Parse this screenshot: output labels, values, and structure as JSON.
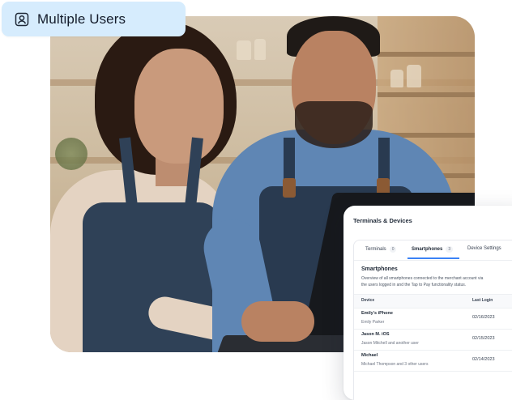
{
  "badge": {
    "label": "Multiple Users",
    "icon": "user-square-icon"
  },
  "card": {
    "title": "Terminals & Devices",
    "tabs": [
      {
        "label": "Terminals",
        "count": "0",
        "active": false
      },
      {
        "label": "Smartphones",
        "count": "3",
        "active": true
      },
      {
        "label": "Device Settings",
        "count": "",
        "active": false
      }
    ],
    "section_title": "Smartphones",
    "description_line1": "Overview of all smartphones connected to the merchant account via",
    "description_line2": "the users logged in and the Tap to Pay functionality status.",
    "columns": {
      "device": "Device",
      "last_login": "Last Login"
    },
    "rows": [
      {
        "device": "Emily's iPhone",
        "user": "Emily Parker",
        "last_login": "02/16/2023"
      },
      {
        "device": "Jason M. iOS",
        "user": "Jason Mitchell and another user",
        "last_login": "02/15/2023"
      },
      {
        "device": "Michael",
        "user": "Michael Thompson and 3 other users",
        "last_login": "02/14/2023"
      }
    ]
  },
  "colors": {
    "badge_bg": "#d6ecfd",
    "accent": "#3b82f6",
    "text_dark": "#141c2b"
  }
}
